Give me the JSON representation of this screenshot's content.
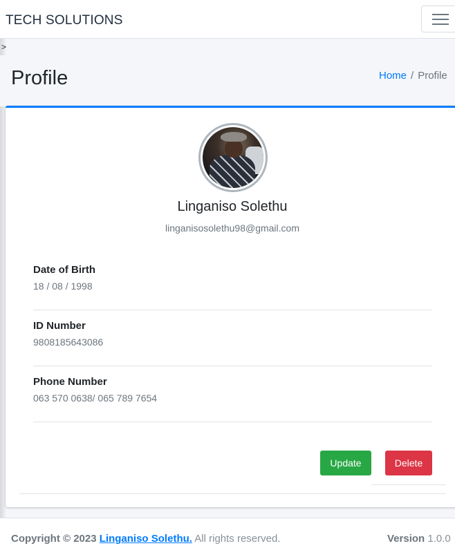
{
  "navbar": {
    "brand": "TECH SOLUTIONS",
    "menu_icon": "hamburger-menu-icon"
  },
  "stray_text": ">",
  "header": {
    "title": "Profile",
    "breadcrumb": {
      "home": "Home",
      "separator": "/",
      "current": "Profile"
    }
  },
  "profile": {
    "name": "Linganiso Solethu",
    "email": "linganisosolethu98@gmail.com",
    "fields": [
      {
        "label": "Date of Birth",
        "value": "18 / 08 / 1998"
      },
      {
        "label": "ID Number",
        "value": "9808185643086"
      },
      {
        "label": "Phone Number",
        "value": "063 570 0638/ 065 789 7654"
      }
    ]
  },
  "actions": {
    "update_label": "Update",
    "delete_label": "Delete"
  },
  "footer": {
    "copyright_prefix": "Copyright © 2023",
    "owner": "Linganiso Solethu.",
    "rights": "All rights reserved.",
    "version_label": "Version",
    "version_value": "1.0.0"
  },
  "colors": {
    "primary": "#007bff",
    "success": "#28a745",
    "danger": "#dc3545",
    "muted": "#6c757d"
  }
}
